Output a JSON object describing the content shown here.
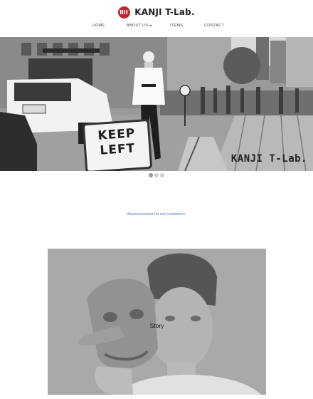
{
  "header": {
    "brand_name": "KANJI T-Lab.",
    "logo_icon": "grill-badge-icon",
    "accent_color": "#c2272d",
    "nav": [
      {
        "label": "HOME"
      },
      {
        "label": "ABOUT US",
        "has_dropdown": true
      },
      {
        "label": "ITEMS"
      },
      {
        "label": "CONTACT"
      }
    ]
  },
  "hero": {
    "sign_line1": "KEEP",
    "sign_line2": "LEFT",
    "watermark": "KANJI T-Lab.",
    "slides_total": 3,
    "active_slide": 1
  },
  "announcement": {
    "text": "Announcement for our customers.",
    "color": "#4a7fc4"
  },
  "story": {
    "label": "Story"
  }
}
